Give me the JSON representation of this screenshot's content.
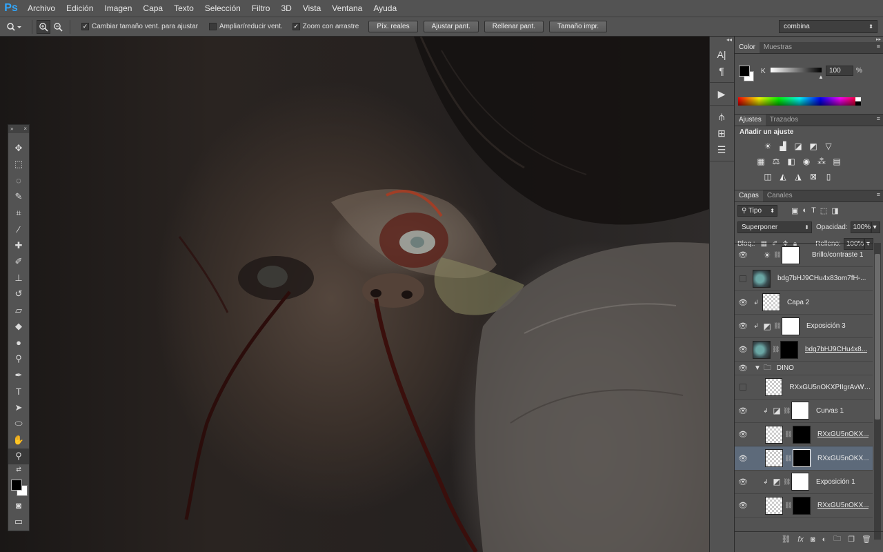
{
  "app": {
    "logo": "Ps"
  },
  "menu": [
    "Archivo",
    "Edición",
    "Imagen",
    "Capa",
    "Texto",
    "Selección",
    "Filtro",
    "3D",
    "Vista",
    "Ventana",
    "Ayuda"
  ],
  "options": {
    "tool_icon": "zoom-icon",
    "resize_windows_label": "Cambiar tamaño vent. para ajustar",
    "resize_windows_checked": true,
    "zoom_all_label": "Ampliar/reducir vent.",
    "zoom_all_checked": false,
    "scrubby_label": "Zoom con arrastre",
    "scrubby_checked": true,
    "btn_actual": "Píx. reales",
    "btn_fit": "Ajustar pant.",
    "btn_fill": "Rellenar pant.",
    "btn_print": "Tamaño impr.",
    "workspace": "combina"
  },
  "color_panel": {
    "tabs": [
      "Color",
      "Muestras"
    ],
    "channel": "K",
    "value": "100",
    "unit": "%"
  },
  "adjust_panel": {
    "tabs": [
      "Ajustes",
      "Trazados"
    ],
    "title": "Añadir un ajuste"
  },
  "layers_panel": {
    "tabs": [
      "Capas",
      "Canales"
    ],
    "filter": "Tipo",
    "blend_mode": "Superponer",
    "opacity_label": "Opacidad:",
    "opacity": "100%",
    "lock_label": "Bloq.:",
    "fill_label": "Relleno:",
    "fill": "100%",
    "layers": [
      {
        "name": "Brillo/contraste 1",
        "visible": true
      },
      {
        "name": "bdg7bHJ9CHu4x83om7fH-...",
        "visible": false
      },
      {
        "name": "Capa 2",
        "visible": true
      },
      {
        "name": "Exposición 3",
        "visible": true
      },
      {
        "name": "bdg7bHJ9CHu4x8...",
        "visible": true
      },
      {
        "name": "DINO",
        "visible": true
      },
      {
        "name": "RXxGU5nOKXPIIgrAvWu...",
        "visible": false
      },
      {
        "name": "Curvas 1",
        "visible": true
      },
      {
        "name": "RXxGU5nOKX...",
        "visible": true
      },
      {
        "name": "RXxGU5nOKX...",
        "visible": true
      },
      {
        "name": "Exposición 1",
        "visible": true
      },
      {
        "name": "RXxGU5nOKX...",
        "visible": true
      }
    ]
  }
}
